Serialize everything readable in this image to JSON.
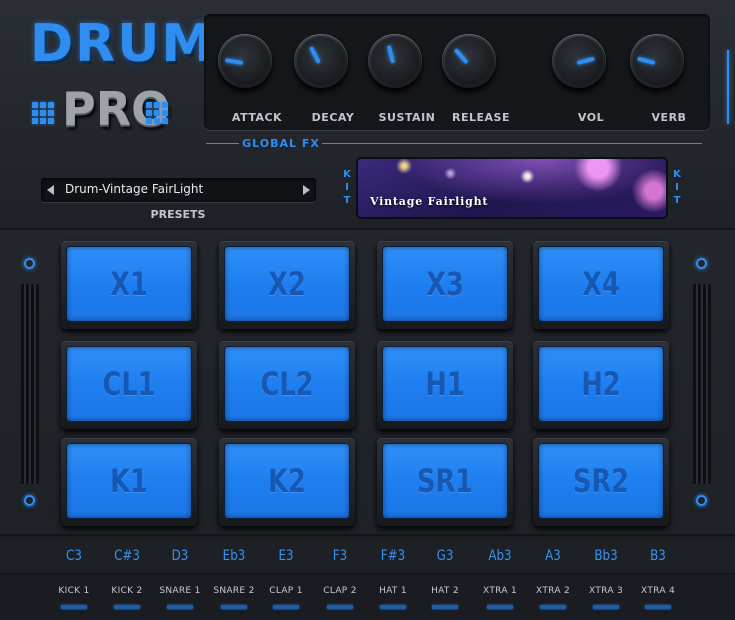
{
  "logo": {
    "top": "DRUM",
    "bottom": "PRO"
  },
  "fx": {
    "knobs": [
      {
        "label": "ATTACK",
        "value": 0.2
      },
      {
        "label": "DECAY",
        "value": 0.4
      },
      {
        "label": "SUSTAIN",
        "value": 0.45
      },
      {
        "label": "RELEASE",
        "value": 0.35
      },
      {
        "label": "VOL",
        "value": 0.78
      },
      {
        "label": "VERB",
        "value": 0.22
      }
    ],
    "section_label": "GLOBAL FX"
  },
  "preset": {
    "name": "Drum-Vintage FairLight",
    "label": "PRESETS"
  },
  "kit": {
    "side_label": "KIT",
    "name": "Vintage Fairlight"
  },
  "pads": [
    "X1",
    "X2",
    "X3",
    "X4",
    "CL1",
    "CL2",
    "H1",
    "H2",
    "K1",
    "K2",
    "SR1",
    "SR2"
  ],
  "notes": [
    "C3",
    "C#3",
    "D3",
    "Eb3",
    "E3",
    "F3",
    "F#3",
    "G3",
    "Ab3",
    "A3",
    "Bb3",
    "B3"
  ],
  "pad_names": [
    "KICK 1",
    "KICK 2",
    "SNARE 1",
    "SNARE 2",
    "CLAP 1",
    "CLAP 2",
    "HAT 1",
    "HAT 2",
    "XTRA 1",
    "XTRA 2",
    "XTRA 3",
    "XTRA 4"
  ],
  "colors": {
    "accent": "#2f8df0",
    "pad": "#1f7ff0",
    "pad_text": "#1658b4"
  }
}
